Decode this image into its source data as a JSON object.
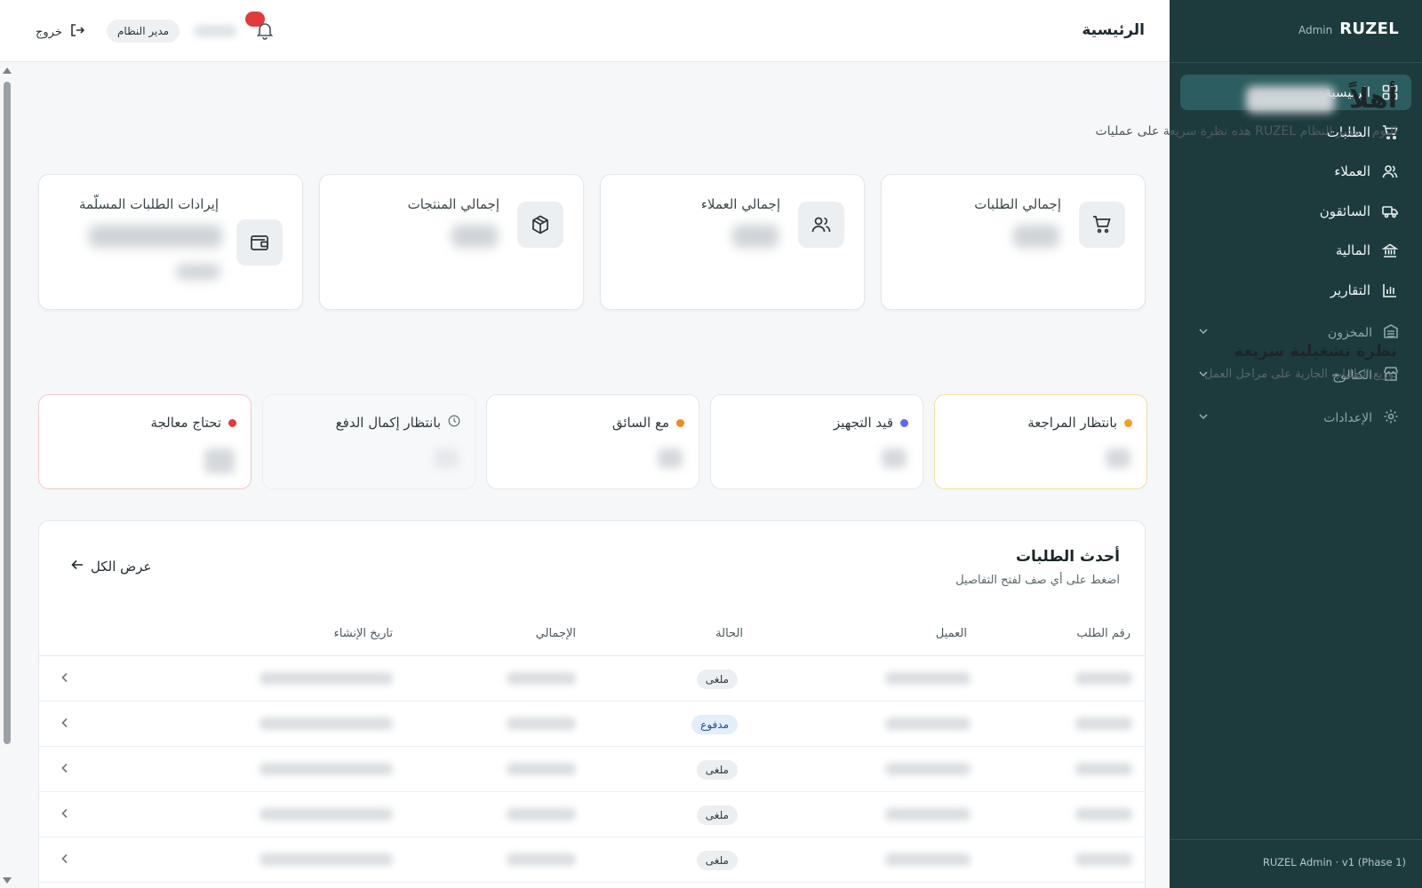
{
  "sidebar": {
    "brand": "RUZEL",
    "brand_sub": "Admin",
    "items": [
      {
        "label": "الرئيسية",
        "icon": "grid-icon",
        "active": true
      },
      {
        "label": "الطلبات",
        "icon": "cart-icon"
      },
      {
        "label": "العملاء",
        "icon": "users-icon"
      },
      {
        "label": "السائقون",
        "icon": "truck-icon"
      },
      {
        "label": "المالية",
        "icon": "bank-icon"
      },
      {
        "label": "التقارير",
        "icon": "bar-chart-icon"
      }
    ],
    "groups": [
      {
        "label": "المخزون",
        "icon": "warehouse-icon"
      },
      {
        "label": "الكتالوج",
        "icon": "store-icon"
      },
      {
        "label": "الإعدادات",
        "icon": "gear-icon"
      }
    ],
    "footer": "RUZEL Admin · v1 (Phase 1)"
  },
  "header": {
    "title": "الرئيسية",
    "role": "مدير النظام",
    "logout": "خروج"
  },
  "greeting": {
    "title": "أهلاً",
    "subtitle": "هذه نظرة سريعة على عمليات RUZEL اليوم · مدير النظام"
  },
  "stats": [
    {
      "label": "إجمالي الطلبات",
      "icon": "cart-icon"
    },
    {
      "label": "إجمالي العملاء",
      "icon": "users-icon"
    },
    {
      "label": "إجمالي المنتجات",
      "icon": "box-icon"
    },
    {
      "label": "إيرادات الطلبات المسلّمة",
      "icon": "wallet-icon"
    }
  ],
  "overview": {
    "title": "نظرة تشغيلية سريعة",
    "subtitle": "توزيع الطلبات الجارية على مراحل العمل",
    "stages": [
      {
        "label": "بانتظار المراجعة",
        "color": "#f0a21b"
      },
      {
        "label": "قيد التجهيز",
        "color": "#6366f1"
      },
      {
        "label": "مع السائق",
        "color": "#f08a1b"
      },
      {
        "label": "بانتظار إكمال الدفع",
        "icon": "clock-icon"
      },
      {
        "label": "تحتاج معالجة",
        "color": "#e23b3b"
      }
    ]
  },
  "orders": {
    "title": "أحدث الطلبات",
    "subtitle": "اضغط على أي صف لفتح التفاصيل",
    "view_all": "عرض الكل",
    "columns": [
      "رقم الطلب",
      "العميل",
      "الحالة",
      "الإجمالي",
      "تاريخ الإنشاء"
    ],
    "rows": [
      {
        "status": "ملغى"
      },
      {
        "status": "مدفوع"
      },
      {
        "status": "ملغى"
      },
      {
        "status": "ملغى"
      },
      {
        "status": "ملغى"
      }
    ]
  }
}
